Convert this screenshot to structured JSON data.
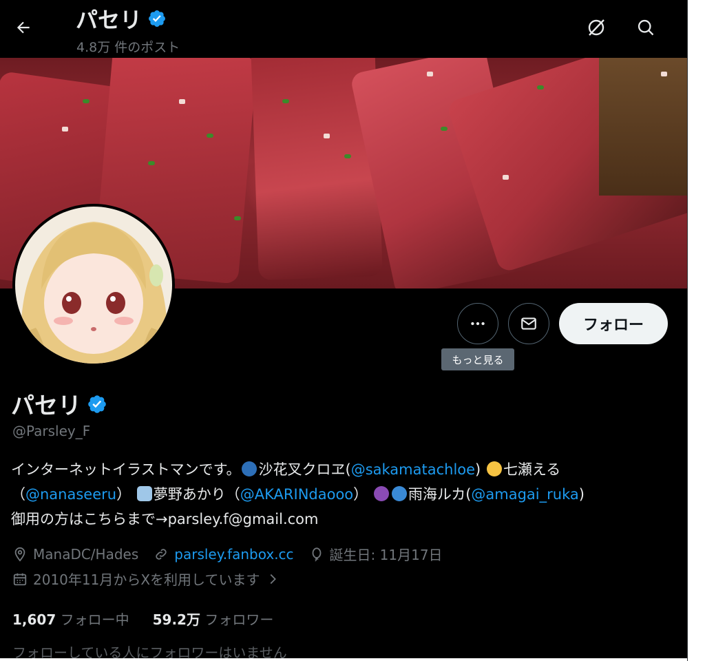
{
  "header": {
    "name": "パセリ",
    "post_count": "4.8万 件のポスト",
    "icons": {
      "back": "back-arrow-icon",
      "grok": "grok-icon",
      "search": "search-icon"
    }
  },
  "profile": {
    "name": "パセリ",
    "handle": "@Parsley_F",
    "verified": true,
    "bio": {
      "line1_a": "インターネットイラストマンです。",
      "line1_b": "沙花叉クロヱ(",
      "line1_link": "@sakamatachloe",
      "line1_c": ")",
      "line1_d": "七瀬える",
      "line2_a": "（",
      "line2_link1": "@nanaseeru",
      "line2_b": "）",
      "line2_c": "夢野あかり（",
      "line2_link2": "@AKARINdaooo",
      "line2_d": "）",
      "line2_e": "雨海ルカ(",
      "line2_link3": "@amagai_ruka",
      "line2_f": ")",
      "line3": "御用の方はこちらまで→parsley.f@gmail.com"
    },
    "location": "ManaDC/Hades",
    "website": "parsley.fanbox.cc",
    "birthday": "誕生日: 11月17日",
    "joined": "2010年11月からXを利用しています",
    "following_count": "1,607",
    "following_label": "フォロー中",
    "followers_count": "59.2万",
    "followers_label": "フォロワー",
    "followers_you_know": "フォローしている人にフォロワーはいません"
  },
  "actions": {
    "more_tooltip": "もっと見る",
    "follow_label": "フォロー"
  },
  "colors": {
    "accent": "#1d9bf0",
    "background": "#000000",
    "muted": "#71767b",
    "text": "#e7e9ea"
  }
}
